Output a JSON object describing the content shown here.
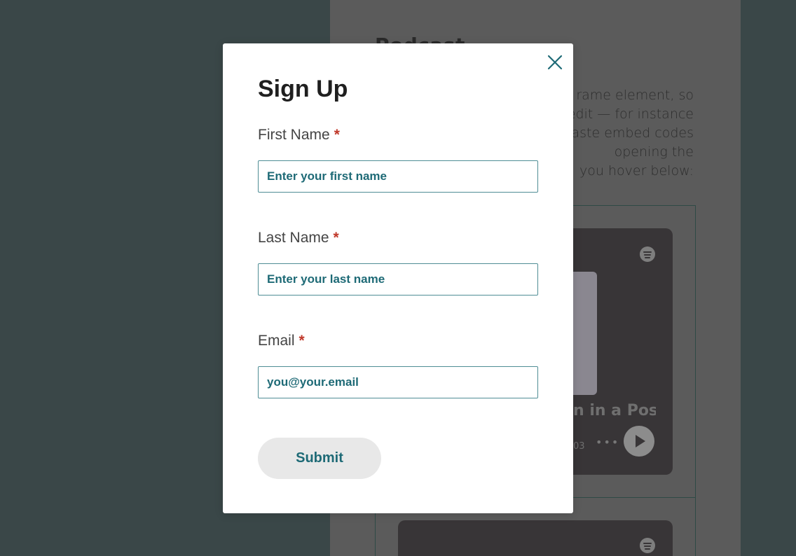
{
  "background": {
    "heading": "Podcast",
    "paragraph_lines": [
      "rame element, so",
      "edit — for instance",
      "aste embed codes",
      "opening the",
      "you hover below:"
    ],
    "episode_title_fragment": "n in a Post-I",
    "episode_time_fragment": "03"
  },
  "modal": {
    "title": "Sign Up",
    "required_mark": "*",
    "fields": {
      "first_name": {
        "label": "First Name",
        "placeholder": "Enter your first name"
      },
      "last_name": {
        "label": "Last Name",
        "placeholder": "Enter your last name"
      },
      "email": {
        "label": "Email",
        "placeholder": "you@your.email"
      }
    },
    "submit_label": "Submit",
    "close_icon": "close-icon"
  },
  "colors": {
    "accent": "#1e6a76",
    "required": "#c0392b",
    "overlay": "#3a4748",
    "submit_bg": "#e8e8e8"
  }
}
